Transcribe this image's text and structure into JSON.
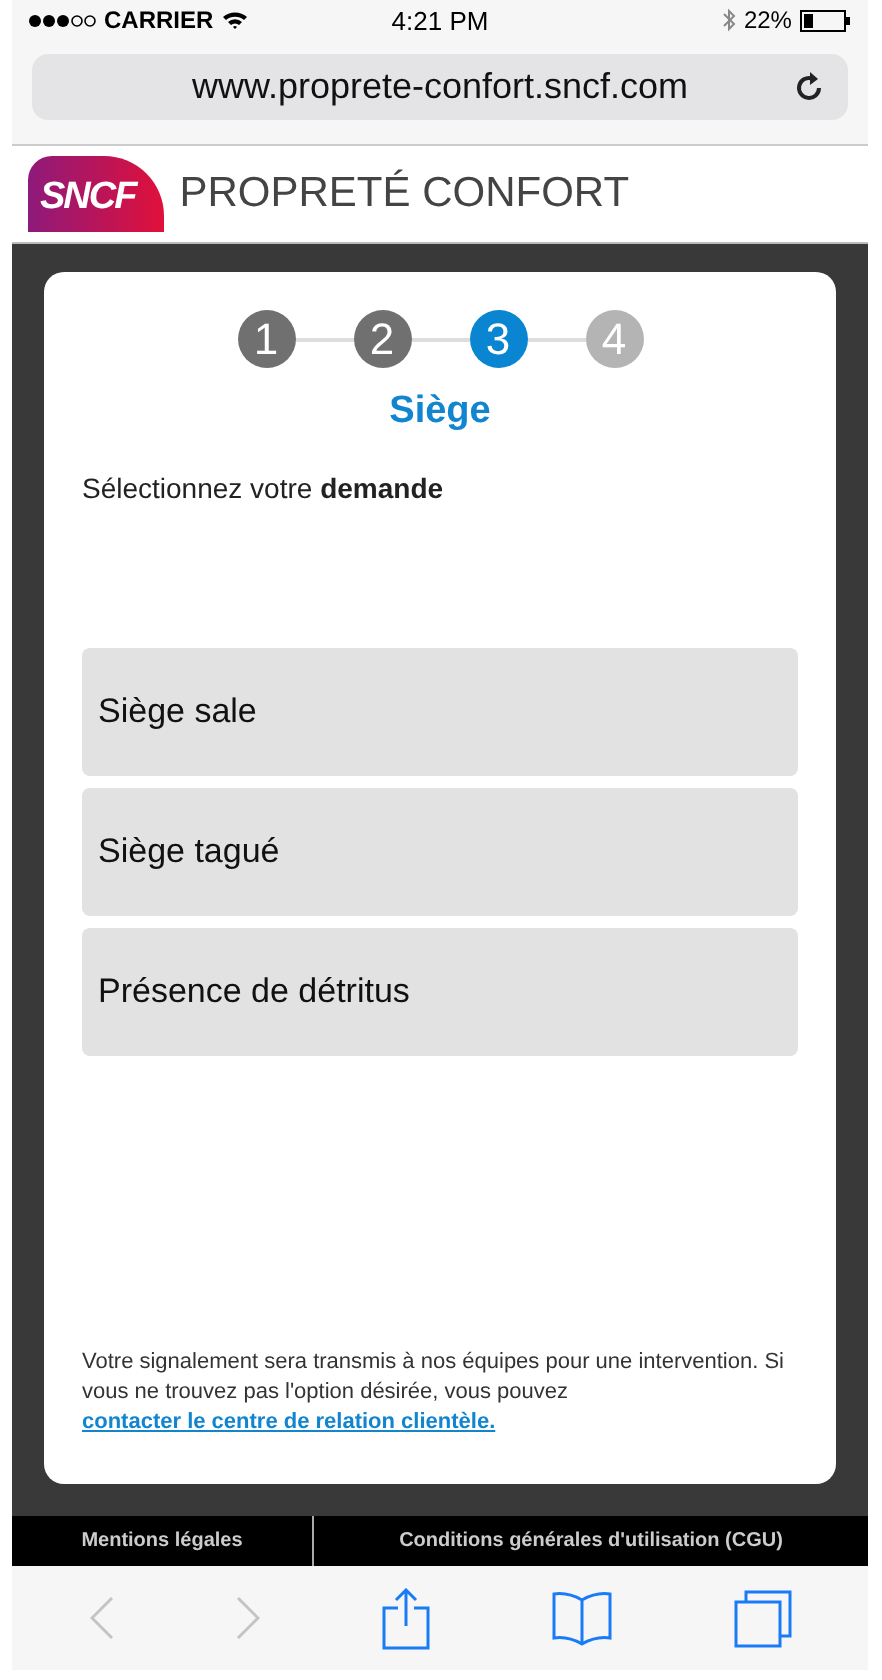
{
  "status_bar": {
    "carrier": "CARRIER",
    "time": "4:21 PM",
    "battery": "22%"
  },
  "browser": {
    "url": "www.proprete-confort.sncf.com"
  },
  "header": {
    "logo": "SNCF",
    "title": "PROPRETÉ CONFORT"
  },
  "steps": [
    {
      "label": "1",
      "done": true,
      "selected": false
    },
    {
      "label": "2",
      "done": true,
      "selected": false
    },
    {
      "label": "3",
      "done": false,
      "selected": true
    },
    {
      "label": "4",
      "done": false,
      "selected": false
    }
  ],
  "heading": "Siège",
  "prompt": "Sélectionnez votre **demande**",
  "options": [
    "Siège sale",
    "Siège tagué",
    "Présence de détritus"
  ],
  "note": {
    "text": "Votre signalement sera transmis à nos équipes pour une intervention. Si vous ne trouvez pas l'option désirée, vous pouvez ",
    "link": "contacter le centre de relation clientèle."
  },
  "footer": [
    "Mentions légales",
    "Conditions générales d'utilisation (CGU)"
  ]
}
